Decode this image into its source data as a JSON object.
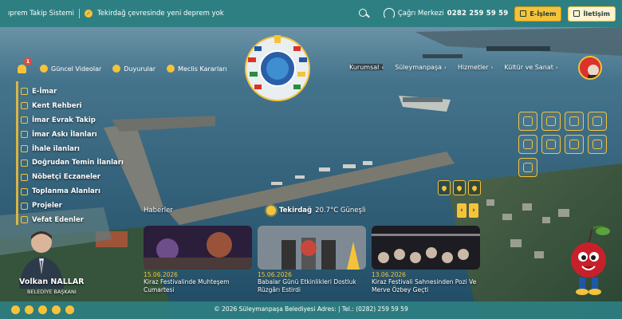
{
  "ticker": {
    "item_1": "ıprem Takip Sistemi",
    "item_2": "Tekirdağ çevresinde yeni deprem yok"
  },
  "topbar": {
    "call_label": "Çağrı Merkezi",
    "call_number": "0282 259 59 59",
    "eislem_label": "E-İşlem",
    "iletisim_label": "İletişim"
  },
  "shortcuts": {
    "badge": "1",
    "videos": "Güncel Videolar",
    "announcements": "Duyurular",
    "council": "Meclis Kararları"
  },
  "menu": [
    {
      "label": "E-İmar"
    },
    {
      "label": "Kent Rehberi"
    },
    {
      "label": "İmar Evrak Takip"
    },
    {
      "label": "İmar Askı İlanları"
    },
    {
      "label": "İhale ilanları"
    },
    {
      "label": "Doğrudan Temin İlanları"
    },
    {
      "label": "Nöbetçi Eczaneler"
    },
    {
      "label": "Toplanma Alanları"
    },
    {
      "label": "Projeler"
    },
    {
      "label": "Vefat Edenler"
    }
  ],
  "nav": {
    "kurumsal": "Kurumsal",
    "suleymanpasa": "Süleymanpaşa",
    "hizmetler": "Hizmetler",
    "kultur": "Kültür ve Sanat"
  },
  "weather": {
    "city": "Tekirdağ",
    "desc": "20.7°C Güneşli"
  },
  "news": {
    "title": "Haberler",
    "cards": [
      {
        "date": "15.06.2026",
        "text": "Kiraz Festivalinde Muhteşem Cumartesi"
      },
      {
        "date": "15.06.2026",
        "text": "Babalar Günü Etkinlikleri Dostluk Rüzgârı Estirdi"
      },
      {
        "date": "13.06.2026",
        "text": "Kiraz Festivali Sahnesinden Pozi Ve Merve Özbey Geçti"
      }
    ]
  },
  "mayor": {
    "name": "Volkan NALLAR",
    "role": "BELEDİYE BAŞKANI"
  },
  "footer": {
    "copyright": "© 2026 Süleymanpaşa Belediyesi Adres: | Tel.: (0282) 259 59 59"
  },
  "colors": {
    "teal": "#2e7f82",
    "yellow": "#f5c33b",
    "red": "#e24a3b"
  }
}
